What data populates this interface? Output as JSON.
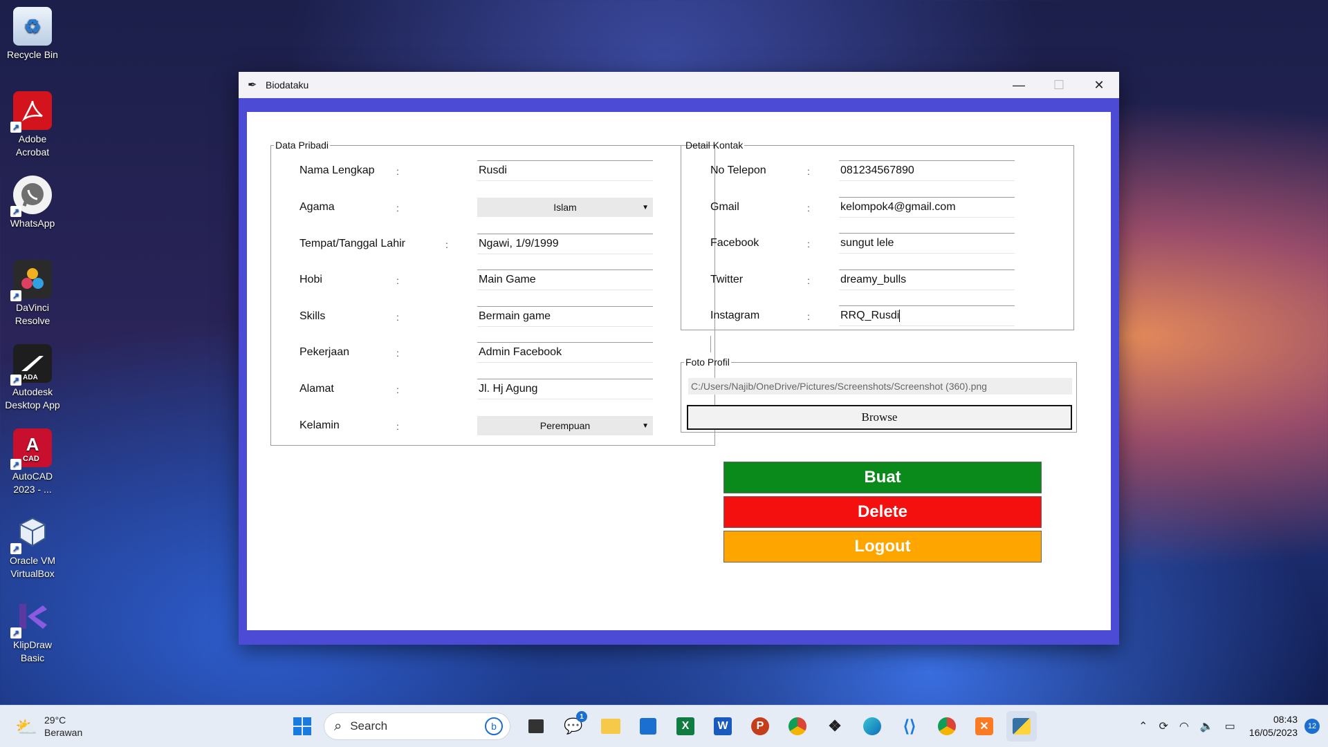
{
  "desktop": {
    "icons": [
      {
        "label": "Recycle Bin"
      },
      {
        "label": "Adobe Acrobat"
      },
      {
        "label": "WhatsApp"
      },
      {
        "label": "DaVinci Resolve"
      },
      {
        "label": "Autodesk Desktop App",
        "badge": "ADA"
      },
      {
        "label": "AutoCAD 2023 - ...",
        "badge": "CAD",
        "glyph": "A"
      },
      {
        "label": "Oracle VM VirtualBox"
      },
      {
        "label": "KlipDraw Basic"
      }
    ]
  },
  "window": {
    "title": "Biodataku",
    "icon": "feather-icon"
  },
  "data_pribadi": {
    "legend": "Data Pribadi",
    "fields": {
      "nama": {
        "label": "Nama Lengkap",
        "value": "Rusdi"
      },
      "agama": {
        "label": "Agama",
        "value": "Islam"
      },
      "ttl": {
        "label": "Tempat/Tanggal Lahir",
        "value": "Ngawi, 1/9/1999"
      },
      "hobi": {
        "label": "Hobi",
        "value": "Main Game"
      },
      "skills": {
        "label": "Skills",
        "value": "Bermain game"
      },
      "pekerjaan": {
        "label": "Pekerjaan",
        "value": "Admin Facebook"
      },
      "alamat": {
        "label": "Alamat",
        "value": "Jl. Hj Agung"
      },
      "kelamin": {
        "label": "Kelamin",
        "value": "Perempuan"
      }
    },
    "colon": ":"
  },
  "detail_kontak": {
    "legend": "Detail Kontak",
    "fields": {
      "telepon": {
        "label": "No Telepon",
        "value": "081234567890"
      },
      "gmail": {
        "label": "Gmail",
        "value": "kelompok4@gmail.com"
      },
      "facebook": {
        "label": "Facebook",
        "value": "sungut lele"
      },
      "twitter": {
        "label": "Twitter",
        "value": "dreamy_bulls"
      },
      "instagram": {
        "label": "Instagram",
        "value": "RRQ_Rusdi"
      }
    }
  },
  "foto_profil": {
    "legend": "Foto Profil",
    "path": "C:/Users/Najib/OneDrive/Pictures/Screenshots/Screenshot (360).png",
    "browse_label": "Browse"
  },
  "actions": {
    "buat": {
      "label": "Buat",
      "color": "#0a8a1a"
    },
    "delete": {
      "label": "Delete",
      "color": "#f51010"
    },
    "logout": {
      "label": "Logout",
      "color": "#ffa500"
    }
  },
  "taskbar": {
    "weather_temp": "29°C",
    "weather_desc": "Berawan",
    "search_label": "Search",
    "teams_badge": "1",
    "clock_time": "08:43",
    "clock_date": "16/05/2023",
    "notification_count": "12"
  }
}
